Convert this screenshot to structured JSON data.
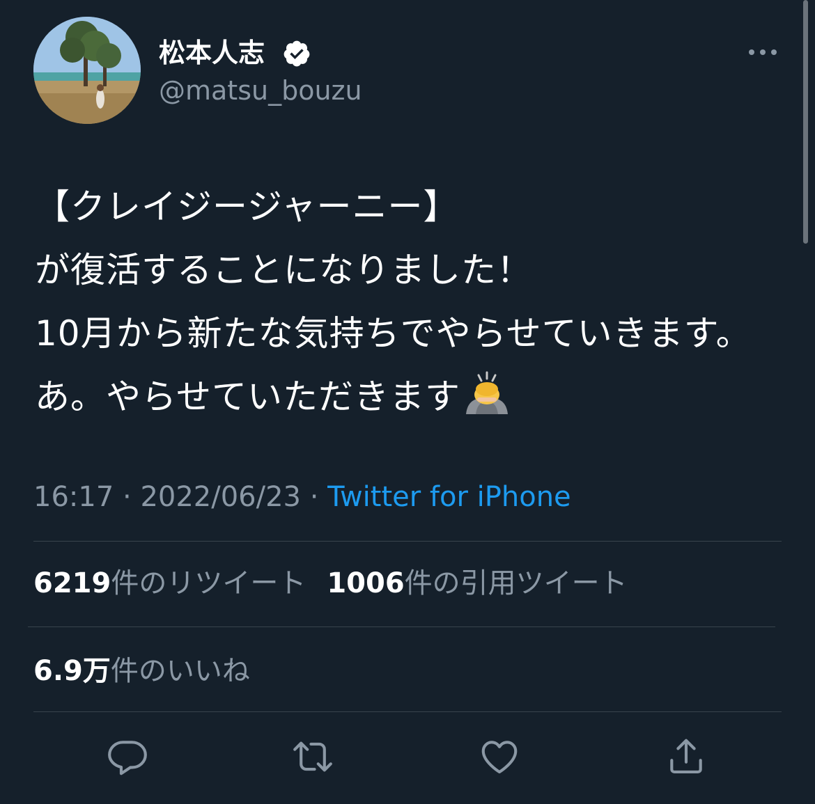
{
  "author": {
    "name": "松本人志",
    "handle": "@matsu_bouzu",
    "verified_icon": "verified-badge-icon"
  },
  "tweet": {
    "text": "【クレイジージャーニー】\nが復活することになりました！\n10月から新たな気持ちでやらせていきます。あ。やらせていただきます",
    "emoji": "person-bowing-emoji"
  },
  "meta": {
    "time": "16:17",
    "separator": "·",
    "date": "2022/06/23",
    "source": "Twitter for iPhone"
  },
  "stats": {
    "retweets_count": "6219",
    "retweets_label": "件のリツイート",
    "quotes_count": "1006",
    "quotes_label": "件の引用ツイート",
    "likes_count": "6.9万",
    "likes_label": "件のいいね"
  },
  "actions": [
    "reply-icon",
    "retweet-icon",
    "like-icon",
    "share-icon"
  ],
  "colors": {
    "background": "#15202b",
    "text": "#ffffff",
    "secondary_text": "#8b98a5",
    "accent": "#1d9bf0",
    "divider": "#38444d"
  }
}
